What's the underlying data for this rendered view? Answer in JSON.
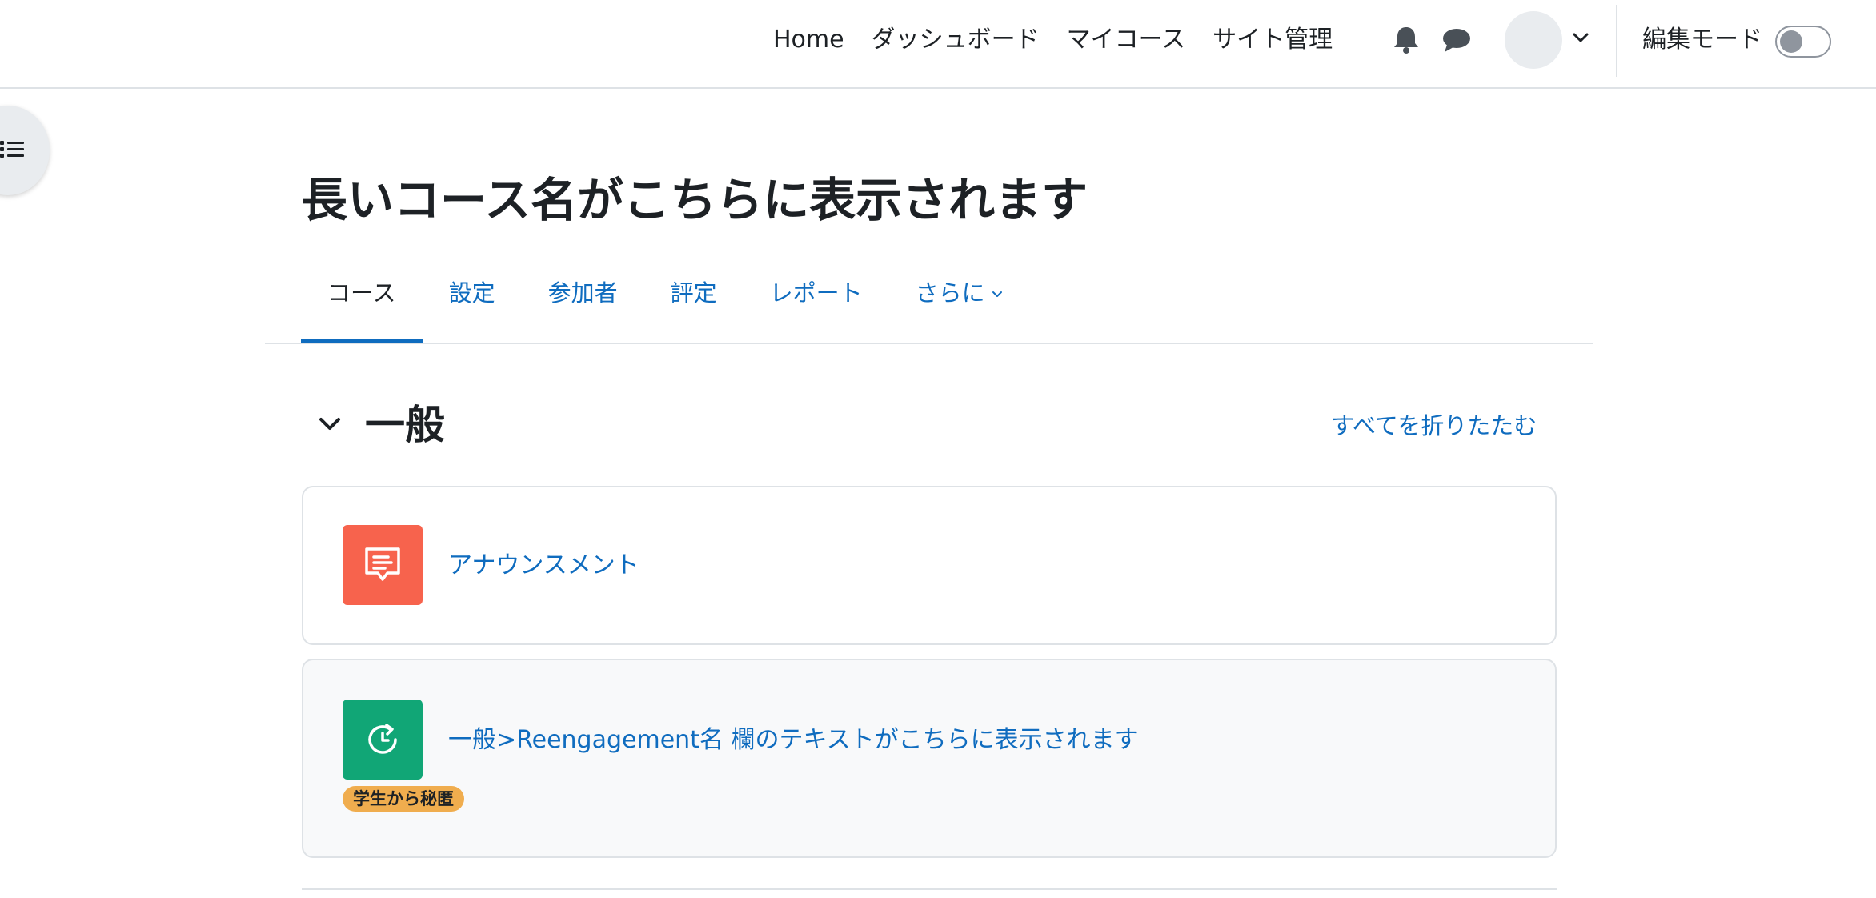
{
  "navbar": {
    "links": [
      "Home",
      "ダッシュボード",
      "マイコース",
      "サイト管理"
    ],
    "edit_mode_label": "編集モード",
    "edit_mode_on": false
  },
  "icons": {
    "notifications": "bell-icon",
    "messages": "chat-icon",
    "user_menu": "chevron-down-icon",
    "course_index": "list-icon"
  },
  "course": {
    "title": "長いコース名がこちらに表示されます"
  },
  "tabs": [
    {
      "label": "コース",
      "active": true
    },
    {
      "label": "設定",
      "active": false
    },
    {
      "label": "参加者",
      "active": false
    },
    {
      "label": "評定",
      "active": false
    },
    {
      "label": "レポート",
      "active": false
    },
    {
      "label": "さらに",
      "active": false,
      "dropdown": true
    }
  ],
  "section": {
    "title": "一般",
    "collapse_all": "すべてを折りたたむ"
  },
  "activities": [
    {
      "name": "アナウンスメント",
      "icon": "forum-icon",
      "icon_color": "#f7634d"
    },
    {
      "name": "一般>Reengagement名 欄のテキストがこちらに表示されます",
      "icon": "reengagement-icon",
      "icon_color": "#11a676",
      "badge": "学生から秘匿"
    }
  ],
  "colors": {
    "link": "#0f6cbf",
    "text": "#1d2125",
    "border": "#dee2e6"
  }
}
